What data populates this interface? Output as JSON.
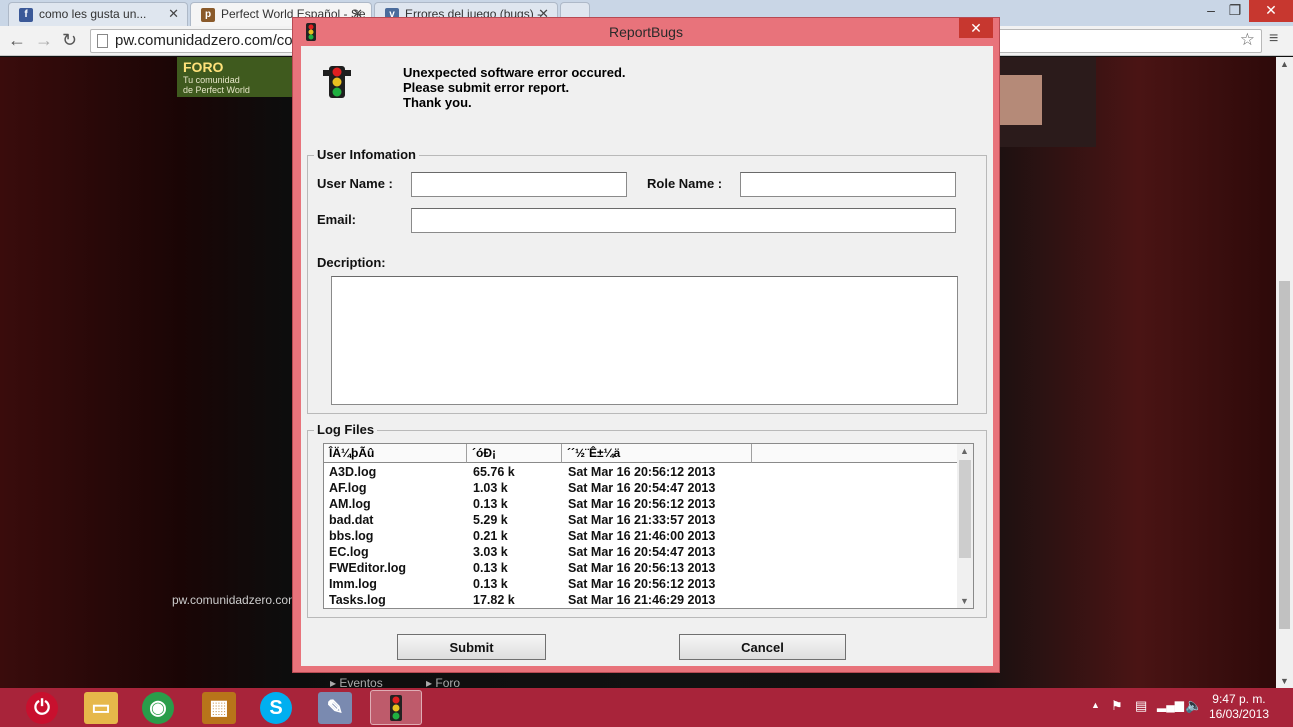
{
  "browser": {
    "tabs": [
      {
        "label": "como les gusta un...",
        "icon": "f",
        "color": "#3b5998"
      },
      {
        "label": "Perfect World Español - Se",
        "icon": "p",
        "color": "#8a5a2a"
      },
      {
        "label": "Errores del juego (bugs) -",
        "icon": "v",
        "color": "#4a6c9c"
      }
    ],
    "address": "pw.comunidadzero.com/com"
  },
  "page": {
    "foro_big": "FORO",
    "foro_small_1": "Tu comunidad",
    "foro_small_2": "de Perfect World",
    "site_url": "pw.comunidadzero.com",
    "footer_links": [
      "▸ Eventos",
      "▸ Foro"
    ]
  },
  "dialog": {
    "title": "ReportBugs",
    "message": [
      "Unexpected software error occured.",
      "Please submit error report.",
      "Thank you."
    ],
    "user_info": {
      "legend": "User Infomation",
      "user_name_label": "User Name :",
      "user_name_value": "",
      "role_name_label": "Role Name :",
      "role_name_value": "",
      "email_label": "Email:",
      "email_value": "",
      "description_label": "Decription:",
      "description_value": ""
    },
    "log_files": {
      "legend": "Log Files",
      "columns": [
        "ÎÄ¼þÃû",
        "´óÐ¡",
        "´´½¨Ê±¼ä"
      ],
      "rows": [
        {
          "name": "A3D.log",
          "size": "65.76 k",
          "date": "Sat Mar 16 20:56:12 2013"
        },
        {
          "name": "AF.log",
          "size": "1.03 k",
          "date": "Sat Mar 16 20:54:47 2013"
        },
        {
          "name": "AM.log",
          "size": "0.13 k",
          "date": "Sat Mar 16 20:56:12 2013"
        },
        {
          "name": "bad.dat",
          "size": "5.29 k",
          "date": "Sat Mar 16 21:33:57 2013"
        },
        {
          "name": "bbs.log",
          "size": "0.21 k",
          "date": "Sat Mar 16 21:46:00 2013"
        },
        {
          "name": "EC.log",
          "size": "3.03 k",
          "date": "Sat Mar 16 20:54:47 2013"
        },
        {
          "name": "FWEditor.log",
          "size": "0.13 k",
          "date": "Sat Mar 16 20:56:13 2013"
        },
        {
          "name": "Imm.log",
          "size": "0.13 k",
          "date": "Sat Mar 16 20:56:12 2013"
        },
        {
          "name": "Tasks.log",
          "size": "17.82 k",
          "date": "Sat Mar 16 21:46:29 2013"
        }
      ]
    },
    "submit_label": "Submit",
    "cancel_label": "Cancel"
  },
  "taskbar": {
    "time": "9:47 p. m.",
    "date": "16/03/2013"
  },
  "colors": {
    "dialog_frame": "#e8737b",
    "taskbar": "#a8243a",
    "close_red": "#c7372f"
  }
}
